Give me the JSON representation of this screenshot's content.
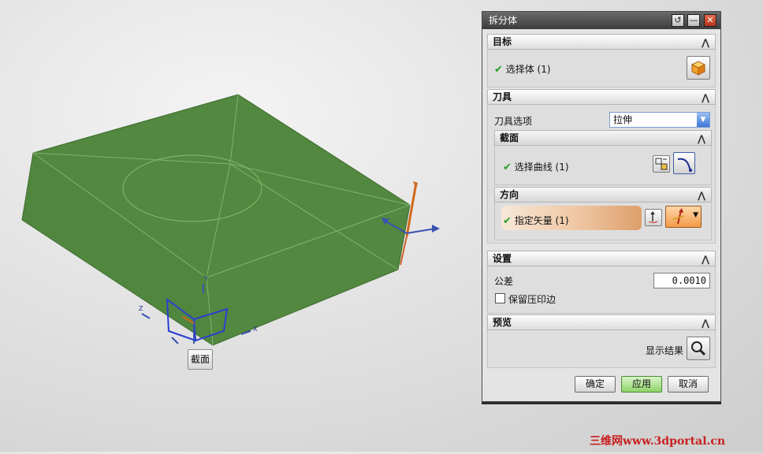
{
  "dialog": {
    "title": "拆分体",
    "titlebar_buttons": [
      "reset-icon",
      "minimize-icon",
      "close-icon"
    ],
    "target": {
      "header": "目标",
      "select_body_label": "选择体 (1)"
    },
    "tool": {
      "header": "刀具",
      "tool_option_label": "刀具选项",
      "tool_option_value": "拉伸",
      "section": {
        "header": "截面",
        "select_curve_label": "选择曲线 (1)"
      },
      "direction": {
        "header": "方向",
        "specify_vector_label": "指定矢量 (1)"
      }
    },
    "settings": {
      "header": "设置",
      "tolerance_label": "公差",
      "tolerance_value": "0.0010",
      "keep_imprint_label": "保留压印边",
      "keep_imprint_checked": false
    },
    "preview": {
      "header": "预览",
      "show_result_label": "显示结果"
    },
    "buttons": {
      "ok": "确定",
      "apply": "应用",
      "cancel": "取消"
    }
  },
  "viewport": {
    "section_tag": "截面",
    "triad_labels": {
      "z": "Z",
      "y": "Y",
      "x": "X"
    },
    "model_color": "#4e8a40"
  },
  "watermark": "三维网www.3dportal.cn"
}
